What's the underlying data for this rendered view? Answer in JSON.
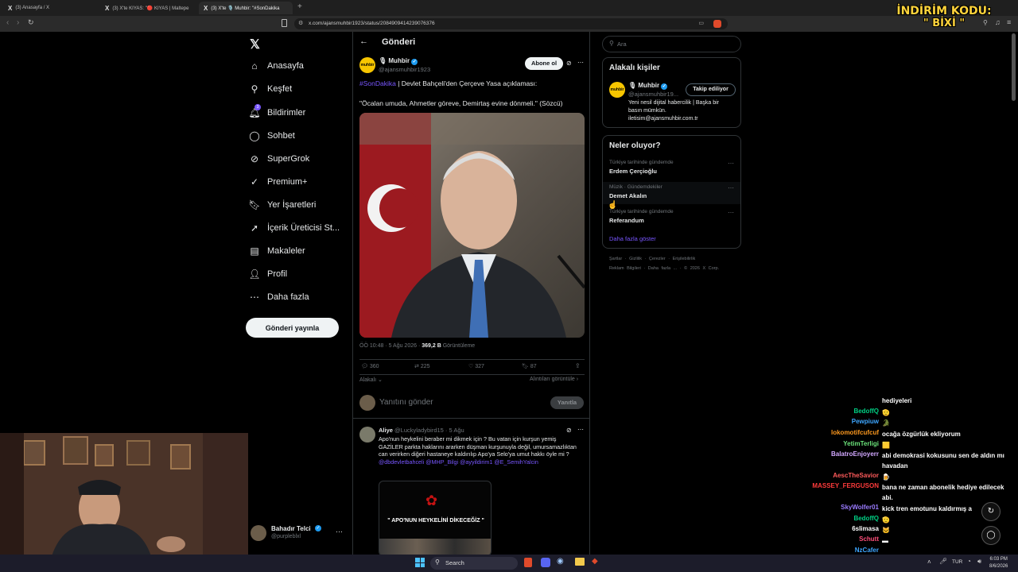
{
  "browser": {
    "tabs": [
      {
        "label": "(3) Anasayfa / X"
      },
      {
        "label": "(3) X'te KIYAS: \"🔴 KIYAS | Maltepe"
      },
      {
        "label": "(3) X'te 🎙️ Muhbir: \"#SonDakika"
      }
    ],
    "url": "x.com/ajansmuhbir1923/status/2084909414239076376",
    "promo_line1": "İNDİRİM KODU:",
    "promo_line2": "\" BİXİ \""
  },
  "nav": {
    "items": [
      {
        "label": "Anasayfa",
        "icon": "home-icon"
      },
      {
        "label": "Keşfet",
        "icon": "search-icon"
      },
      {
        "label": "Bildirimler",
        "icon": "bell-icon",
        "badge": "3"
      },
      {
        "label": "Sohbet",
        "icon": "chat-icon"
      },
      {
        "label": "SuperGrok",
        "icon": "grok-icon"
      },
      {
        "label": "Premium+",
        "icon": "premium-icon"
      },
      {
        "label": "Yer İşaretleri",
        "icon": "bookmark-icon"
      },
      {
        "label": "İçerik Üreticisi St...",
        "icon": "rocket-icon"
      },
      {
        "label": "Makaleler",
        "icon": "article-icon"
      },
      {
        "label": "Profil",
        "icon": "person-icon"
      },
      {
        "label": "Daha fazla",
        "icon": "more-icon"
      }
    ],
    "post_button": "Gönderi yayınla",
    "account_name": "Bahadır Telci",
    "account_handle": "@purpleblxl"
  },
  "post": {
    "header": "Gönderi",
    "author": "Muhbir",
    "handle": "@ajansmuhbir1923",
    "avatar_text": "muhbir",
    "subscribe": "Abone ol",
    "hashtag": "#SonDakika",
    "text1": " | Devlet Bahçeli'den Çerçeve Yasa açıklaması:",
    "text2": "\"Öcalan umuda, Ahmetler göreve, Demirtaş evine dönmeli.\" (Sözcü)",
    "time": "ÖÖ 10:48 · 5 Ağu 2026 ·",
    "views": "369,2 B",
    "views_label": "Görüntüleme",
    "stats": {
      "replies": "360",
      "reposts": "225",
      "likes": "327",
      "bookmarks": "87"
    },
    "relevant": "Alakalı",
    "quotes": "Alıntıları görüntüle",
    "reply_placeholder": "Yanıtını gönder",
    "reply_button": "Yanıtla"
  },
  "reply": {
    "author": "Aliye",
    "handle": "@Luckyladybird15 · 5 Ağu",
    "text": "Apo'nun heykelini beraber mi dikmek için ? Bu vatan için kurşun yemiş GAZİLER parkta haklarını ararken düşman kurşunuyla değil, umursamazlıktan can verirken diğeri hastaneye kaldırılıp Apo'ya Selo'ya umut hakkı öyle mi ? ",
    "mentions": "@dbdevletbahceli @MHP_Bilgi @ayyildirim1 @E_SemihYalcin",
    "image_text": "\" APO'NUN HEYKELİNİ DİKECEĞİZ \""
  },
  "right": {
    "search_placeholder": "Ara",
    "related_title": "Alakalı kişiler",
    "related": {
      "name": "Muhbir",
      "handle": "@ajansmuhbir19...",
      "follow": "Takip ediliyor",
      "bio": "Yeni nesil dijital habercilik | Başka bir basın mümkün. iletisim@ajansmuhbir.com.tr"
    },
    "trends_title": "Neler oluyor?",
    "trends": [
      {
        "context": "Türkiye tarihinde gündemde",
        "name": "Erdem Çerçioğlu"
      },
      {
        "context": "Müzik · Gündemdekiler",
        "name": "Demet Akalın"
      },
      {
        "context": "Türkiye tarihinde gündemde",
        "name": "Referandum"
      }
    ],
    "show_more": "Daha fazla göster",
    "footer1": [
      "Şartlar",
      "Gizlilik",
      "Çerezler",
      "Erişilebilirlik"
    ],
    "footer2": [
      "Reklam Bilgileri",
      "Daha fazla ...",
      "© 2026 X Corp."
    ]
  },
  "chat": [
    {
      "user": "",
      "msg": "hediyeleri",
      "color": "#ffffff"
    },
    {
      "user": "BedoffQ",
      "msg": "🫡",
      "color": "#00d084"
    },
    {
      "user": "Pewpiuw",
      "msg": "🐊",
      "color": "#3ea6ff"
    },
    {
      "user": "lokomotifcufcuf",
      "msg": "ocağa özgürlük ekliyorum",
      "color": "#ff9a1f"
    },
    {
      "user": "YetimTerligi",
      "msg": "🟨",
      "color": "#6be37a"
    },
    {
      "user": "BalatroEnjoyerr",
      "msg": "abi demokrasi kokusunu sen de aldın mı havadan",
      "color": "#d2a8ff"
    },
    {
      "user": "AescTheSavior",
      "msg": "🍺",
      "color": "#ff5b5b"
    },
    {
      "user": "MASSEY_FERGUSON",
      "msg": "bana ne zaman abonelik hediye edilecek abi.",
      "color": "#ff3b3b"
    },
    {
      "user": "SkyWolfer01",
      "msg": "kick tren emotunu kaldırmış a",
      "color": "#9b7bff"
    },
    {
      "user": "BedoffQ",
      "msg": "🫡",
      "color": "#00d084"
    },
    {
      "user": "6slimasa",
      "msg": "🐱",
      "color": "#ffffff"
    },
    {
      "user": "Schutt",
      "msg": "▬",
      "color": "#ff4f7a"
    },
    {
      "user": "NzCafer",
      "msg": "",
      "color": "#3ea6ff"
    }
  ],
  "taskbar": {
    "search": "Search",
    "lang": "TUR",
    "time": "6:03 PM",
    "date": "8/6/2026"
  }
}
